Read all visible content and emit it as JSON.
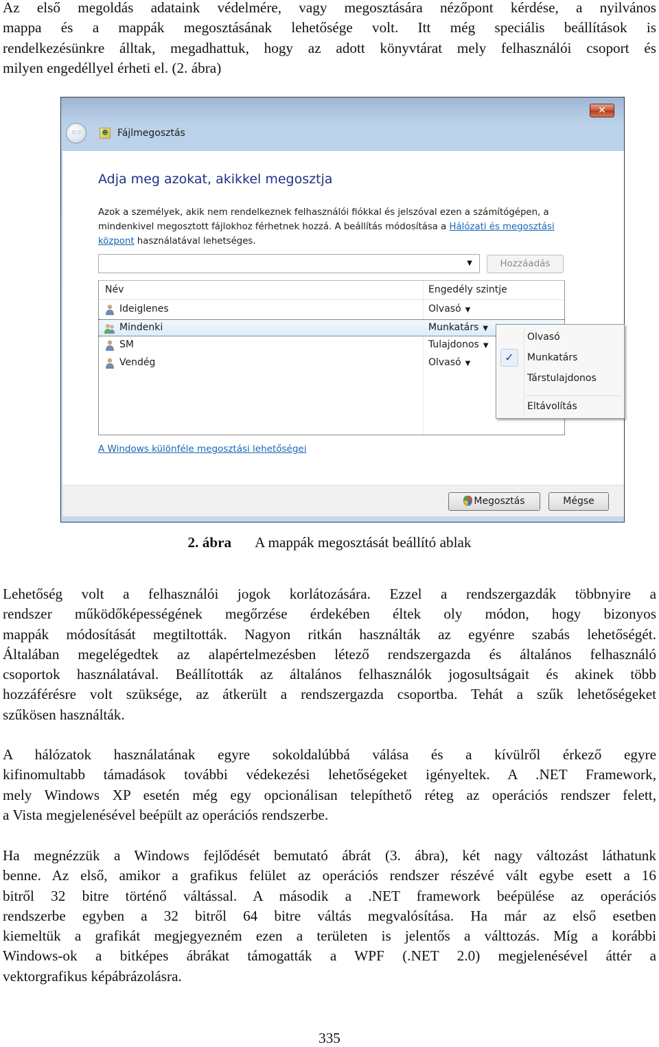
{
  "paragraphs": {
    "intro": [
      "Az első megoldás adataink védelmére, vagy megosztására nézőpont kérdése, a nyilvános",
      "mappa és a mappák megosztásának lehetősége volt. Itt még speciális beállítások is",
      "rendelkezésünkre álltak, megadhattuk, hogy az adott könyvtárat mely felhasználói csoport és",
      "milyen engedéllyel érheti el. (2. ábra)"
    ],
    "p2": [
      "Lehetőség volt a felhasználói jogok korlátozására. Ezzel a rendszergazdák többnyire a",
      "rendszer működőképességének megőrzése érdekében éltek oly módon, hogy bizonyos",
      "mappák módosítását megtiltották. Nagyon ritkán használták az egyénre szabás lehetőségét.",
      "Általában megelégedtek az alapértelmezésben létező rendszergazda és általános felhasználó",
      "csoportok használatával. Beállították az általános felhasználók jogosultságait és akinek több",
      "hozzáférésre volt szüksége, az átkerült a rendszergazda csoportba. Tehát a szűk lehetőségeket",
      "szűkösen használták."
    ],
    "p3": [
      "A hálózatok használatának egyre sokoldalúbbá válása és a kívülről érkező egyre",
      "kifinomultabb támadások további védekezési lehetőségeket igényeltek. A .NET Framework,",
      "mely Windows XP esetén még egy opcionálisan telepíthető réteg az operációs rendszer felett,",
      "a Vista megjelenésével beépült az operációs rendszerbe."
    ],
    "p4": [
      "Ha megnézzük a Windows fejlődését bemutató ábrát (3. ábra), két nagy változást láthatunk",
      "benne. Az első, amikor a grafikus felület az operációs rendszer részévé vált egybe esett a 16",
      "bitről 32 bitre történő váltással. A második a .NET framework beépülése az operációs",
      "rendszerbe egyben a 32 bitről 64 bitre váltás megvalósítása. Ha már az első esetben",
      "kiemeltük a grafikát megjegyezném ezen a területen is jelentős a válttozás. Míg a korábbi",
      "Windows-ok a bitképes ábrákat támogatták a WPF (.NET 2.0) megjelenésével áttér a",
      "vektorgrafikus képábrázolásra."
    ]
  },
  "figure": {
    "number": "2. ábra",
    "caption": "A mappák megosztását beállító ablak"
  },
  "dialog": {
    "title": "Fájlmegosztás",
    "close_glyph": "✕",
    "back_glyph": "⇦",
    "heading": "Adja meg azokat, akikkel megosztja",
    "description_before_link": "Azok a személyek, akik nem rendelkeznek felhasználói fiókkal és jelszóval ezen a számítógépen, a mindenkivel megosztott fájlokhoz férhetnek hozzá. A beállítás módosítása a ",
    "description_link": "Hálózati és megosztási központ",
    "description_after_link": " használatával lehetséges.",
    "combo_value": "",
    "add_button": "Hozzáadás",
    "columns": {
      "name": "Név",
      "permission": "Engedély szintje"
    },
    "users": [
      {
        "name": "Ideiglenes",
        "permission": "Olvasó",
        "icon": "user-icon",
        "selected": false
      },
      {
        "name": "Mindenki",
        "permission": "Munkatárs",
        "icon": "group-icon",
        "selected": true
      },
      {
        "name": "SM",
        "permission": "Tulajdonos",
        "icon": "user-icon",
        "selected": false
      },
      {
        "name": "Vendég",
        "permission": "Olvasó",
        "icon": "user-icon",
        "selected": false
      }
    ],
    "permission_menu": {
      "items": [
        "Olvasó",
        "Munkatárs",
        "Társtulajdonos",
        "Eltávolítás"
      ],
      "checked": "Munkatárs",
      "check_glyph": "✓"
    },
    "help_link": "A Windows különféle megosztási lehetőségei",
    "share_button": "Megosztás",
    "cancel_button": "Mégse"
  },
  "page_number": "335"
}
